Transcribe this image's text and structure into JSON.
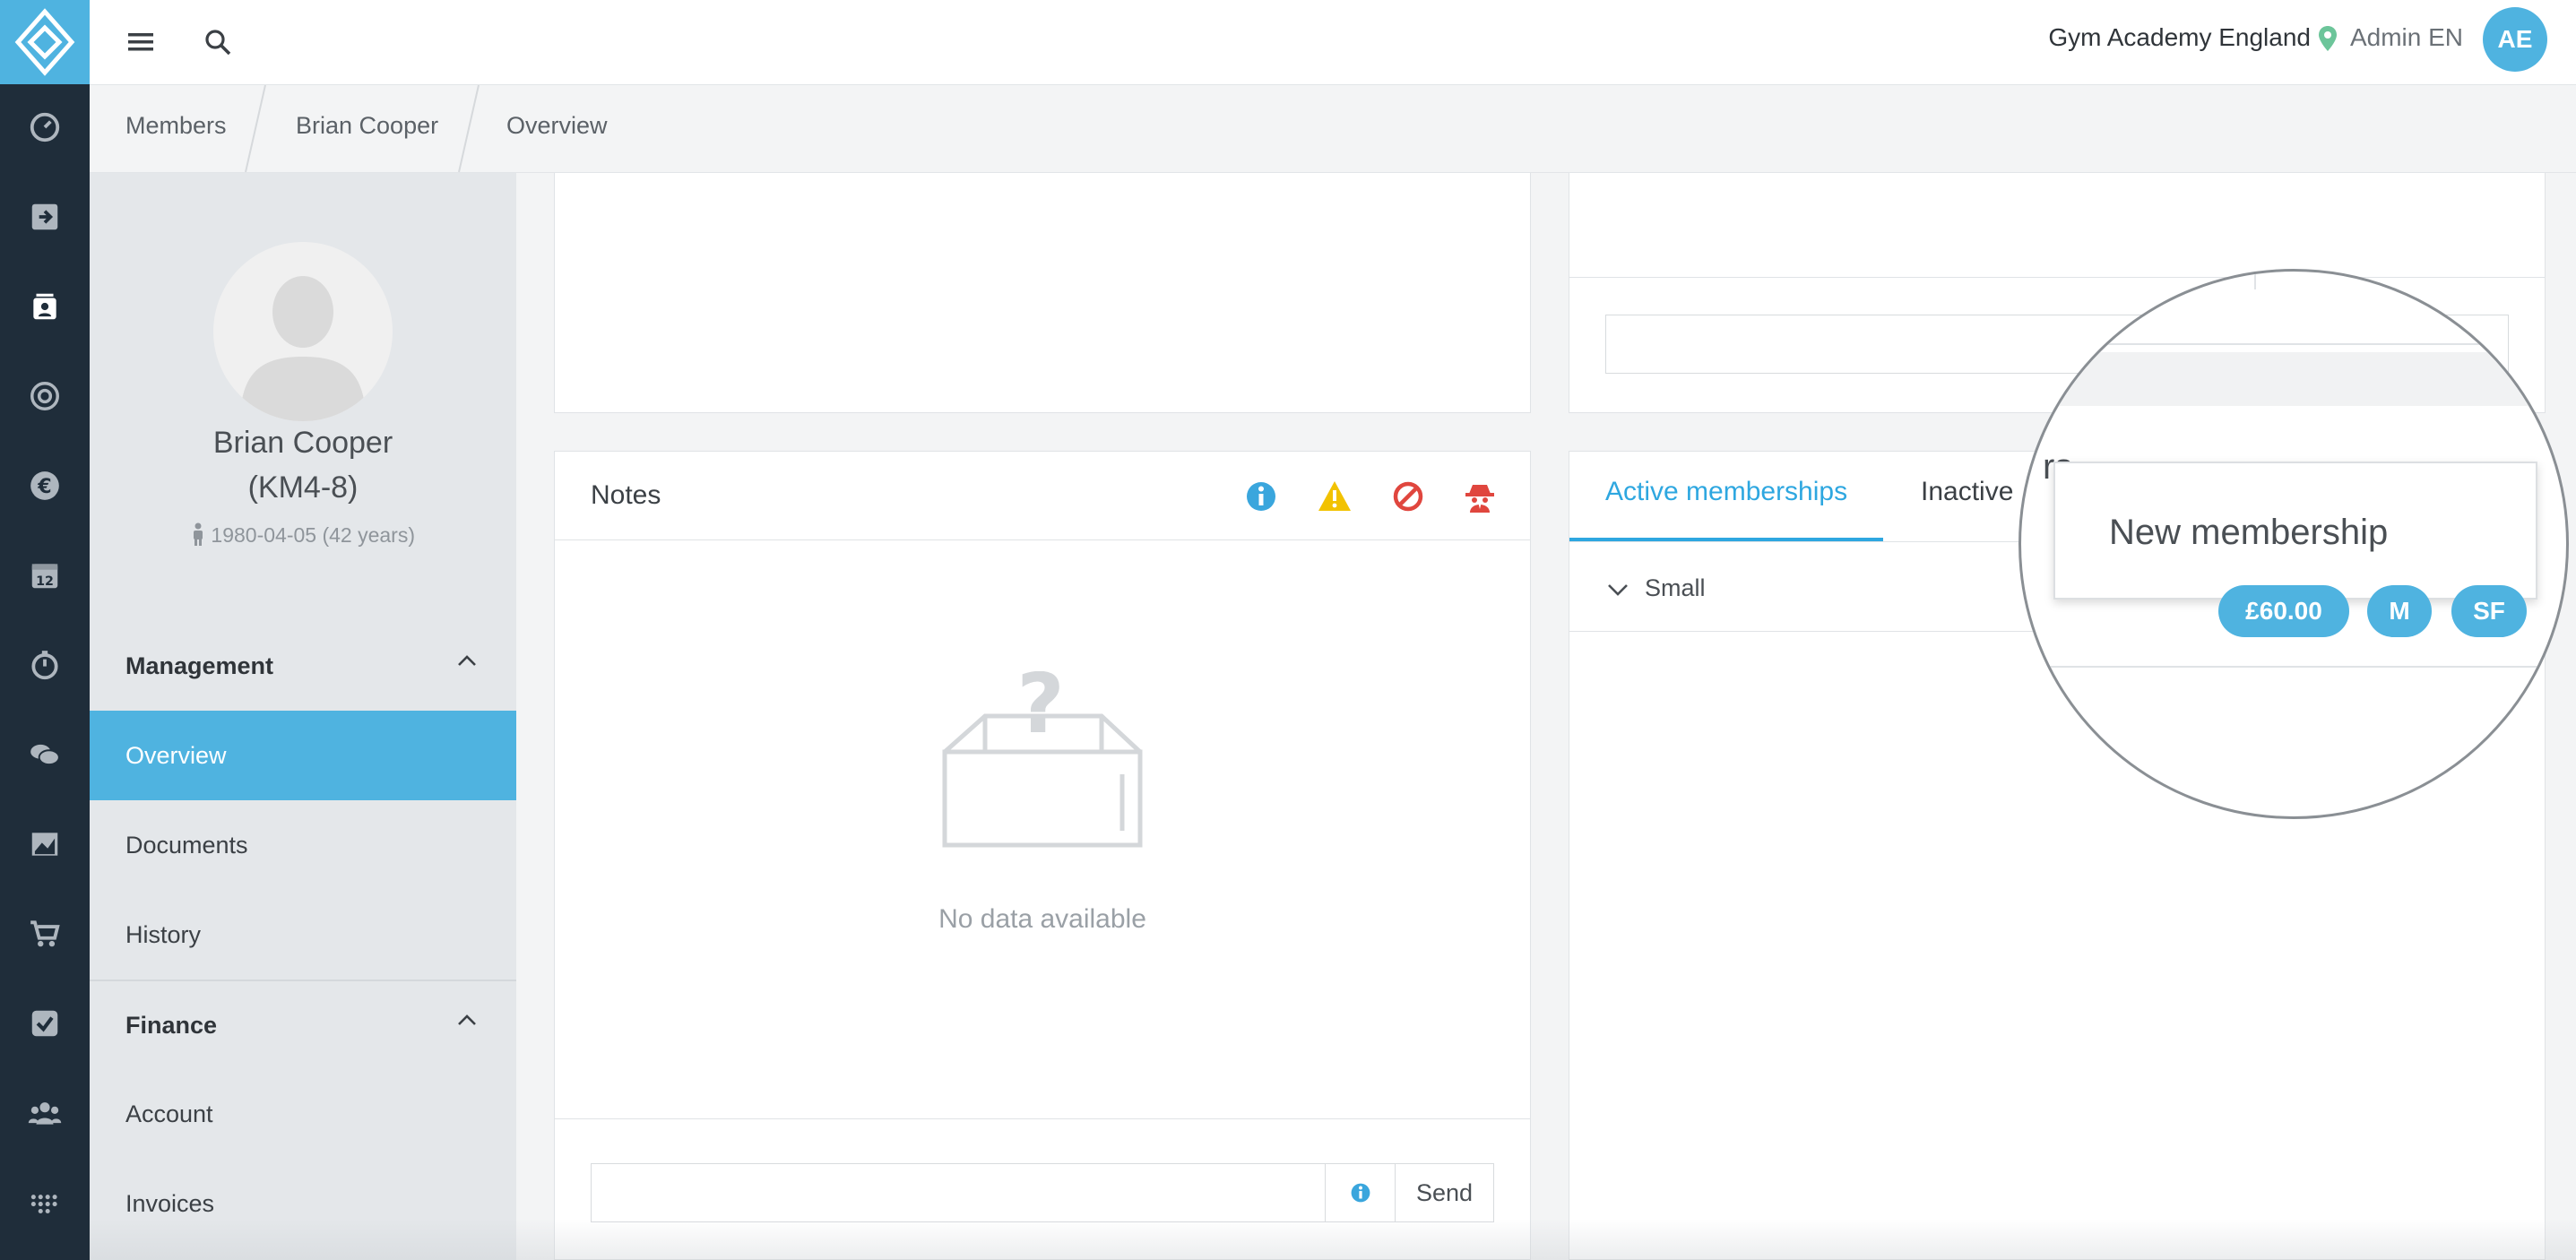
{
  "header": {
    "organization": "Gym Academy England",
    "user_name": "Admin EN",
    "avatar_initials": "AE"
  },
  "breadcrumb": [
    "Members",
    "Brian Cooper",
    "Overview"
  ],
  "member": {
    "name": "Brian Cooper",
    "code": "(KM4-8)",
    "dob": "1980-04-05 (42 years)"
  },
  "sidebar": {
    "management": {
      "title": "Management",
      "items": [
        "Overview",
        "Documents",
        "History"
      ]
    },
    "finance": {
      "title": "Finance",
      "items": [
        "Account",
        "Invoices"
      ]
    }
  },
  "notes": {
    "title": "Notes",
    "empty_text": "No data available",
    "send_label": "Send"
  },
  "memberships": {
    "tabs": [
      "Active memberships",
      "Inactive"
    ],
    "row_label": "Small",
    "price": "£60.00",
    "badge_m": "M",
    "badge_sf": "SF",
    "new_membership": "New membership"
  },
  "colors": {
    "accent": "#4fb3e0",
    "rail": "#1f2d3a",
    "warning": "#f2c200",
    "danger": "#e0463e"
  },
  "icons": {
    "rail": [
      "dashboard-icon",
      "check-in-icon",
      "members-icon",
      "target-icon",
      "euro-icon",
      "calendar-icon",
      "stopwatch-icon",
      "chat-icon",
      "chart-icon",
      "cart-icon",
      "tasks-icon",
      "groups-icon",
      "apps-icon"
    ]
  }
}
